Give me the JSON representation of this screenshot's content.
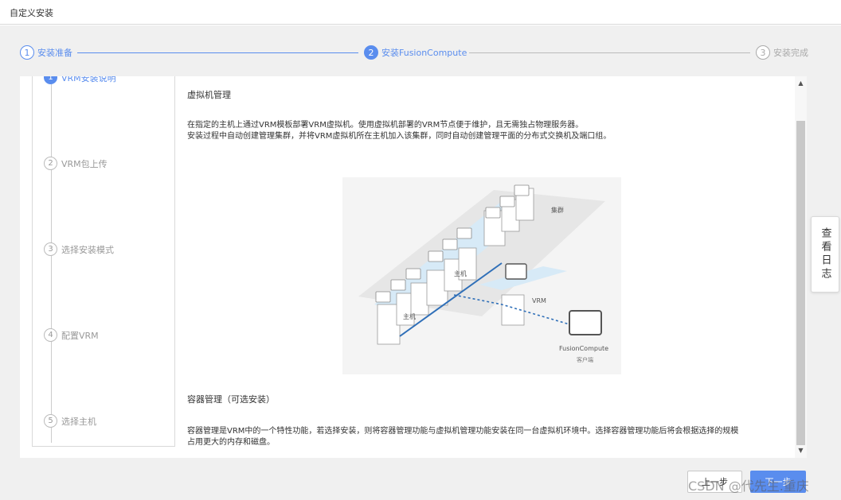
{
  "window": {
    "title": "自定义安装"
  },
  "steps": [
    {
      "num": "1",
      "label": "安装准备"
    },
    {
      "num": "2",
      "label": "安装FusionCompute"
    },
    {
      "num": "3",
      "label": "安装完成"
    }
  ],
  "substeps": [
    {
      "num": "1",
      "label": "VRM安装说明"
    },
    {
      "num": "2",
      "label": "VRM包上传"
    },
    {
      "num": "3",
      "label": "选择安装模式"
    },
    {
      "num": "4",
      "label": "配置VRM"
    },
    {
      "num": "5",
      "label": "选择主机"
    }
  ],
  "content": {
    "section1_title": "虚拟机管理",
    "section1_line1": "在指定的主机上通过VRM模板部署VRM虚拟机。使用虚拟机部署的VRM节点便于维护，且无需独占物理服务器。",
    "section1_line2": "安装过程中自动创建管理集群，并将VRM虚拟机所在主机加入该集群，同时自动创建管理平面的分布式交换机及端口组。",
    "section2_title": "容器管理（可选安装）",
    "section2_line1": "容器管理是VRM中的一个特性功能，若选择安装，则将容器管理功能与虚拟机管理功能安装在同一台虚拟机环境中。选择容器管理功能后将会根据选择的规模",
    "section2_line2": "占用更大的内存和磁盘。"
  },
  "diagram": {
    "cluster_label": "集群",
    "host_label_1": "主机",
    "host_label_2": "主机",
    "vrm_label": "VRM",
    "client_label_1": "FusionCompute",
    "client_label_2": "客户端"
  },
  "side": {
    "log_button": "查看日志"
  },
  "footer": {
    "prev": "上一步",
    "next": "下一步"
  },
  "watermark": "CSDN @代先生.重庆",
  "colors": {
    "accent": "#5a8dee",
    "inactive": "#aaaaaa",
    "background": "#f0f0f0"
  }
}
